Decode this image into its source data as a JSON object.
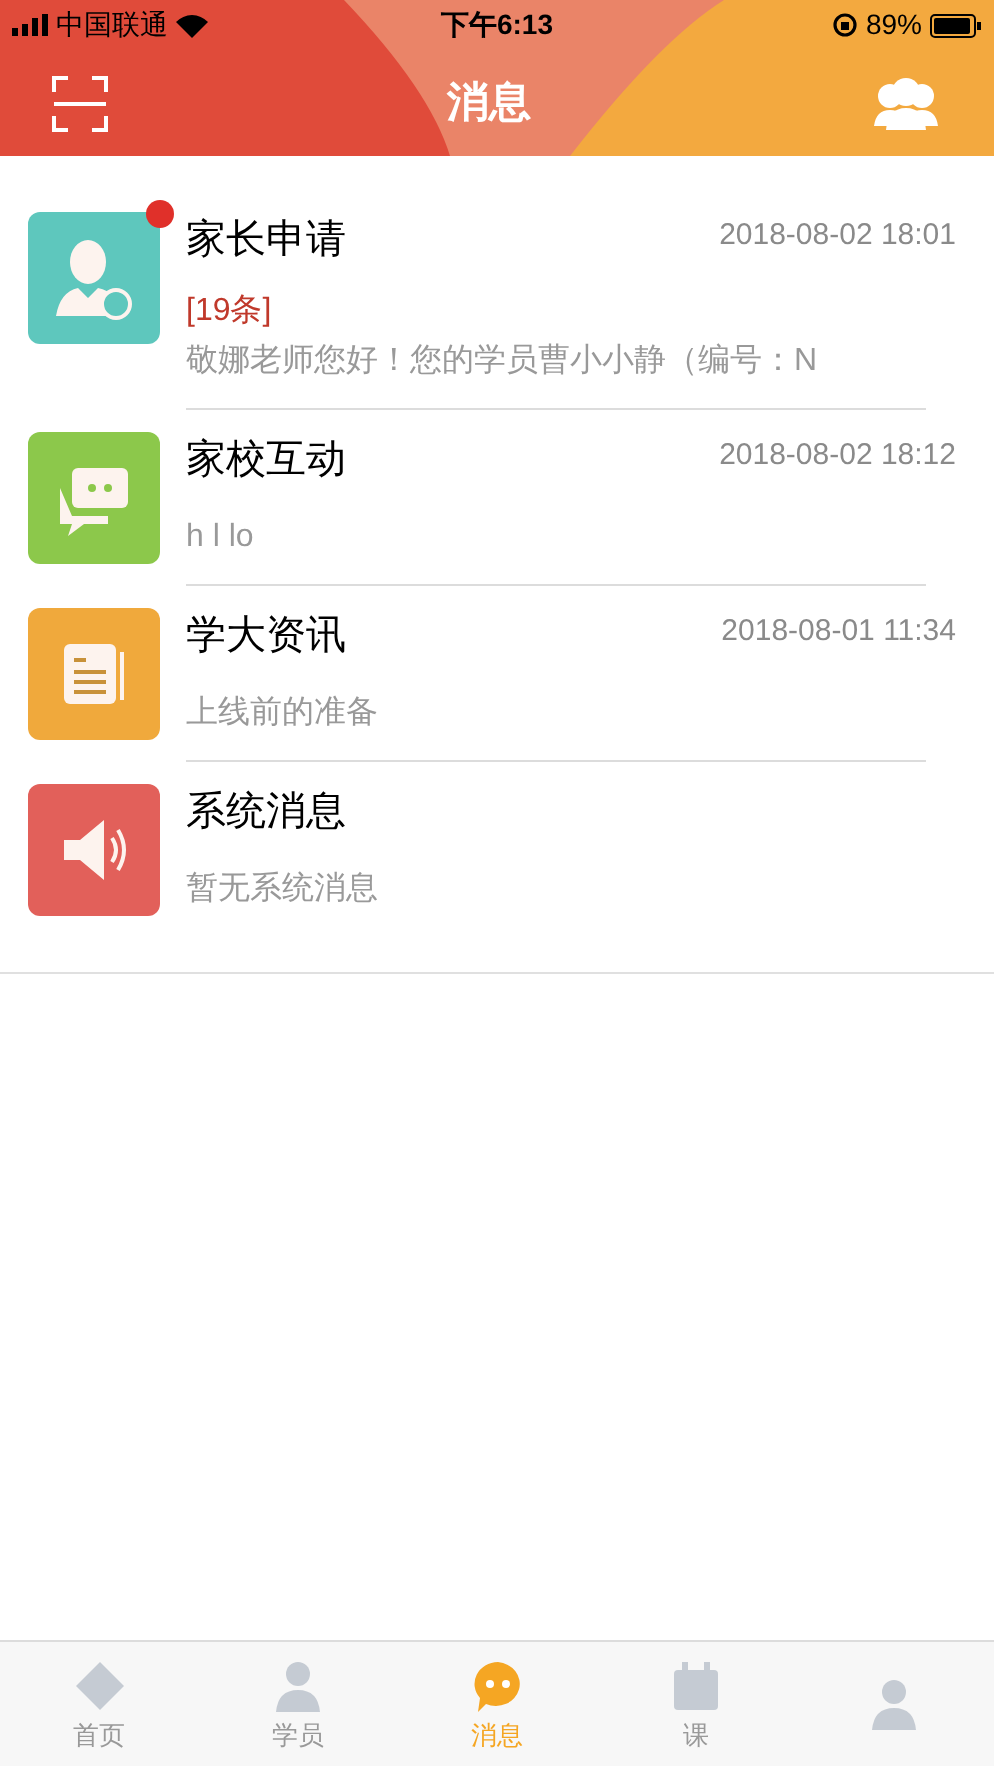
{
  "status_bar": {
    "carrier": "中国联通",
    "time": "下午6:13",
    "battery": "89%"
  },
  "nav": {
    "title": "消息"
  },
  "messages": [
    {
      "kind": "parent",
      "title": "家长申请",
      "time": "2018-08-02 18:01",
      "count": "[19条]",
      "preview": "敬娜老师您好！您的学员曹小小静（编号：N",
      "unread": true
    },
    {
      "kind": "chat",
      "title": "家校互动",
      "time": "2018-08-02 18:12",
      "preview": "h l lo",
      "unread": false
    },
    {
      "kind": "news",
      "title": "学大资讯",
      "time": "2018-08-01 11:34",
      "preview": "上线前的准备",
      "unread": false
    },
    {
      "kind": "system",
      "title": "系统消息",
      "preview": "暂无系统消息",
      "unread": false
    }
  ],
  "tabs": [
    {
      "kind": "home",
      "label": "首页",
      "selected": false
    },
    {
      "kind": "student",
      "label": "学员",
      "selected": false
    },
    {
      "kind": "message",
      "label": "消息",
      "selected": true
    },
    {
      "kind": "course",
      "label": "课",
      "selected": false
    },
    {
      "kind": "me",
      "selected": false
    }
  ]
}
